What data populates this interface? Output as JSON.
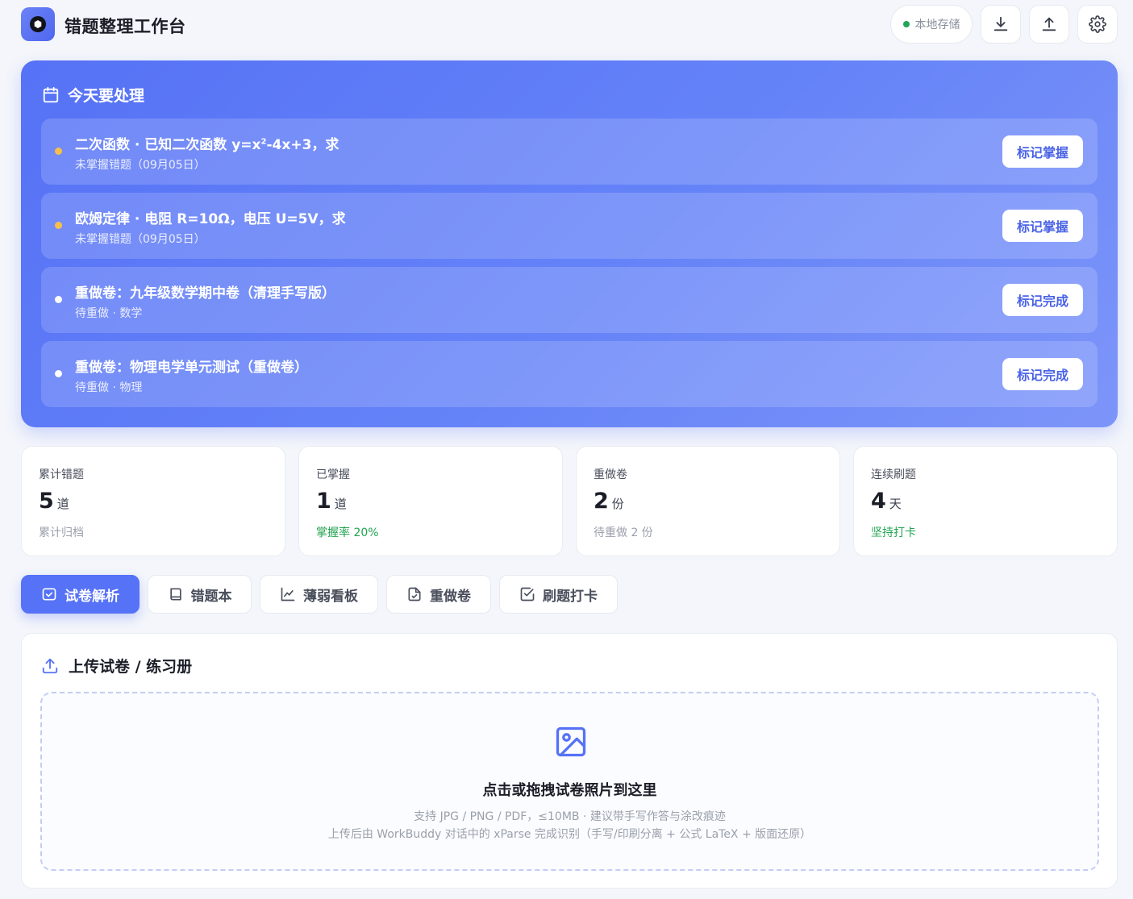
{
  "header": {
    "app_title": "错题整理工作台",
    "storage_label": "本地存储",
    "download_icon": "download-icon",
    "upload_icon": "upload-icon",
    "settings_icon": "gear-icon"
  },
  "today": {
    "title": "今天要处理",
    "tasks": [
      {
        "title_prefix": "二次函数 · 已知二次函数 y=x",
        "title_sup": "2",
        "title_suffix": "-4x+3，求",
        "sub": "未掌握错题（09月05日）",
        "button": "标记掌握",
        "dot_color": "#f7c04a"
      },
      {
        "title": "欧姆定律 · 电阻 R=10Ω，电压 U=5V，求",
        "sub": "未掌握错题（09月05日）",
        "button": "标记掌握",
        "dot_color": "#f7c04a"
      },
      {
        "title": "重做卷：九年级数学期中卷（清理手写版）",
        "sub": "待重做 · 数学",
        "button": "标记完成",
        "dot_color": "#ffffff"
      },
      {
        "title": "重做卷：物理电学单元测试（重做卷）",
        "sub": "待重做 · 物理",
        "button": "标记完成",
        "dot_color": "#ffffff"
      }
    ]
  },
  "stats": [
    {
      "label": "累计错题",
      "value": "5",
      "unit": "道",
      "note": "累计归档"
    },
    {
      "label": "已掌握",
      "value": "1",
      "unit": "道",
      "note": "掌握率 20%"
    },
    {
      "label": "重做卷",
      "value": "2",
      "unit": "份",
      "note": "待重做 2 份"
    },
    {
      "label": "连续刷题",
      "value": "4",
      "unit": "天",
      "note": "坚持打卡"
    }
  ],
  "tabs": [
    {
      "label": "试卷解析",
      "icon": "scan-icon",
      "active": true
    },
    {
      "label": "错题本",
      "icon": "book-icon",
      "active": false
    },
    {
      "label": "薄弱看板",
      "icon": "chart-line-icon",
      "active": false
    },
    {
      "label": "重做卷",
      "icon": "file-check-icon",
      "active": false
    },
    {
      "label": "刷题打卡",
      "icon": "checkbox-icon",
      "active": false
    }
  ],
  "upload": {
    "title": "上传试卷 / 练习册",
    "drop_title": "点击或拖拽试卷照片到这里",
    "drop_line1": "支持 JPG / PNG / PDF，≤10MB · 建议带手写作答与涂改痕迹",
    "drop_line2": "上传后由 WorkBuddy 对话中的 xParse 完成识别（手写/印刷分离 + 公式 LaTeX + 版面还原）"
  },
  "colors": {
    "accent": "#5672f6",
    "dot_pending": "#f7c04a",
    "success": "#20a34f"
  }
}
